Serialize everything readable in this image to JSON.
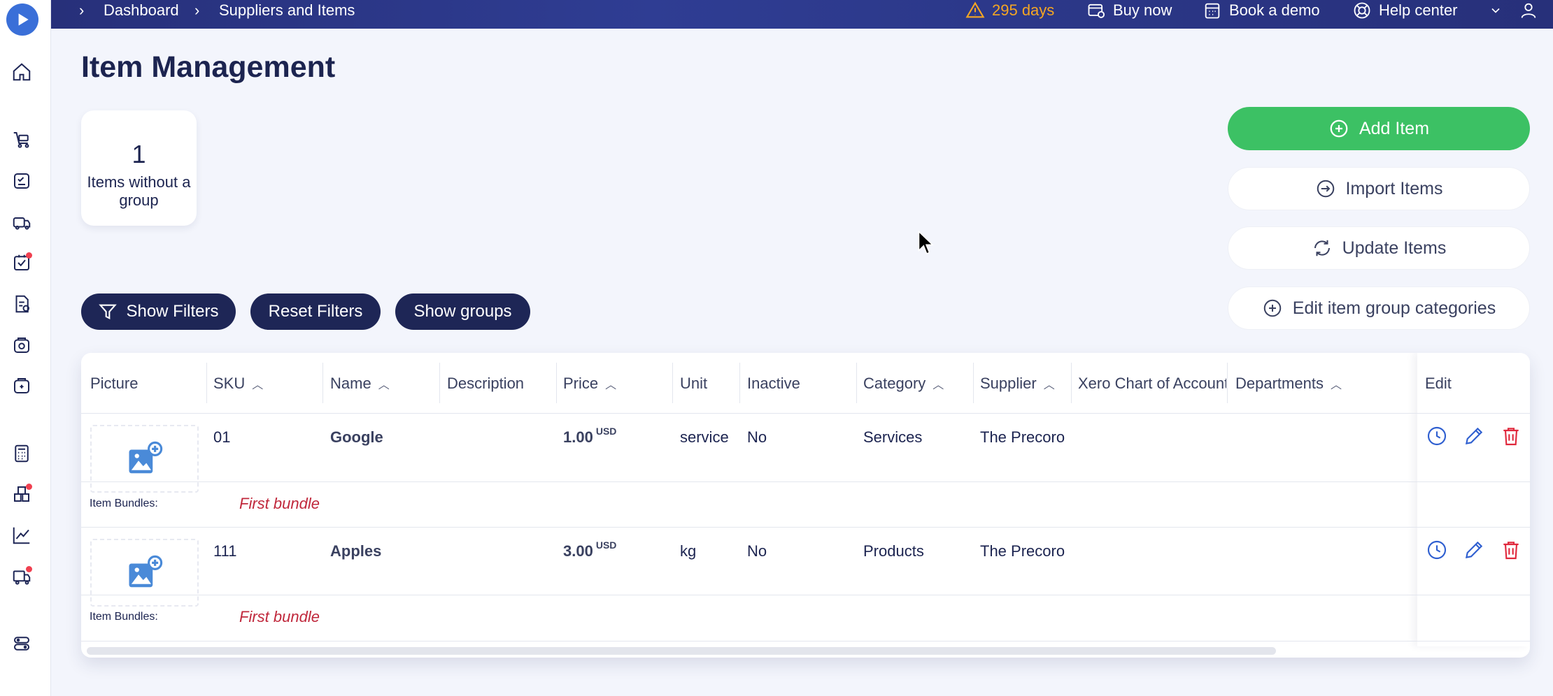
{
  "topbar": {
    "breadcrumbs": [
      "Dashboard",
      "Suppliers and Items"
    ],
    "trial": "295 days",
    "buy_now": "Buy now",
    "book_demo": "Book a demo",
    "help_center": "Help center"
  },
  "sidebar": {
    "icons": [
      "home-icon",
      "cart-icon",
      "requisition-icon",
      "suppliers-icon",
      "approvals-icon",
      "invoices-icon",
      "budget-icon",
      "payments-icon",
      "calculator-icon",
      "items-icon",
      "analytics-icon",
      "delivery-icon",
      "settings-icon"
    ]
  },
  "page": {
    "title": "Item Management"
  },
  "stat": {
    "value": "1",
    "label": "Items without a group"
  },
  "actions": {
    "add_item": "Add Item",
    "import_items": "Import Items",
    "update_items": "Update Items",
    "edit_categories": "Edit item group categories"
  },
  "filters": {
    "show_filters": "Show Filters",
    "reset_filters": "Reset Filters",
    "show_groups": "Show groups"
  },
  "table": {
    "columns": [
      "Picture",
      "SKU",
      "Name",
      "Description",
      "Price",
      "Unit",
      "Inactive",
      "Category",
      "Supplier",
      "Xero Chart of Accounts",
      "Departments",
      "Edit"
    ],
    "bundle_label": "Item Bundles:",
    "rows": [
      {
        "sku": "01",
        "name": "Google",
        "description": "",
        "price": "1.00",
        "currency": "USD",
        "unit": "service",
        "inactive": "No",
        "category": "Services",
        "supplier": "The Precoro",
        "xero": "",
        "departments": "",
        "bundle": "First bundle"
      },
      {
        "sku": "111",
        "name": "Apples",
        "description": "",
        "price": "3.00",
        "currency": "USD",
        "unit": "kg",
        "inactive": "No",
        "category": "Products",
        "supplier": "The Precoro",
        "xero": "",
        "departments": "",
        "bundle": "First bundle"
      }
    ]
  },
  "colors": {
    "primary": "#3cc164",
    "navy": "#1e2656",
    "topbar": "#2b3585",
    "danger": "#e0283c",
    "trial": "#f5a623"
  }
}
